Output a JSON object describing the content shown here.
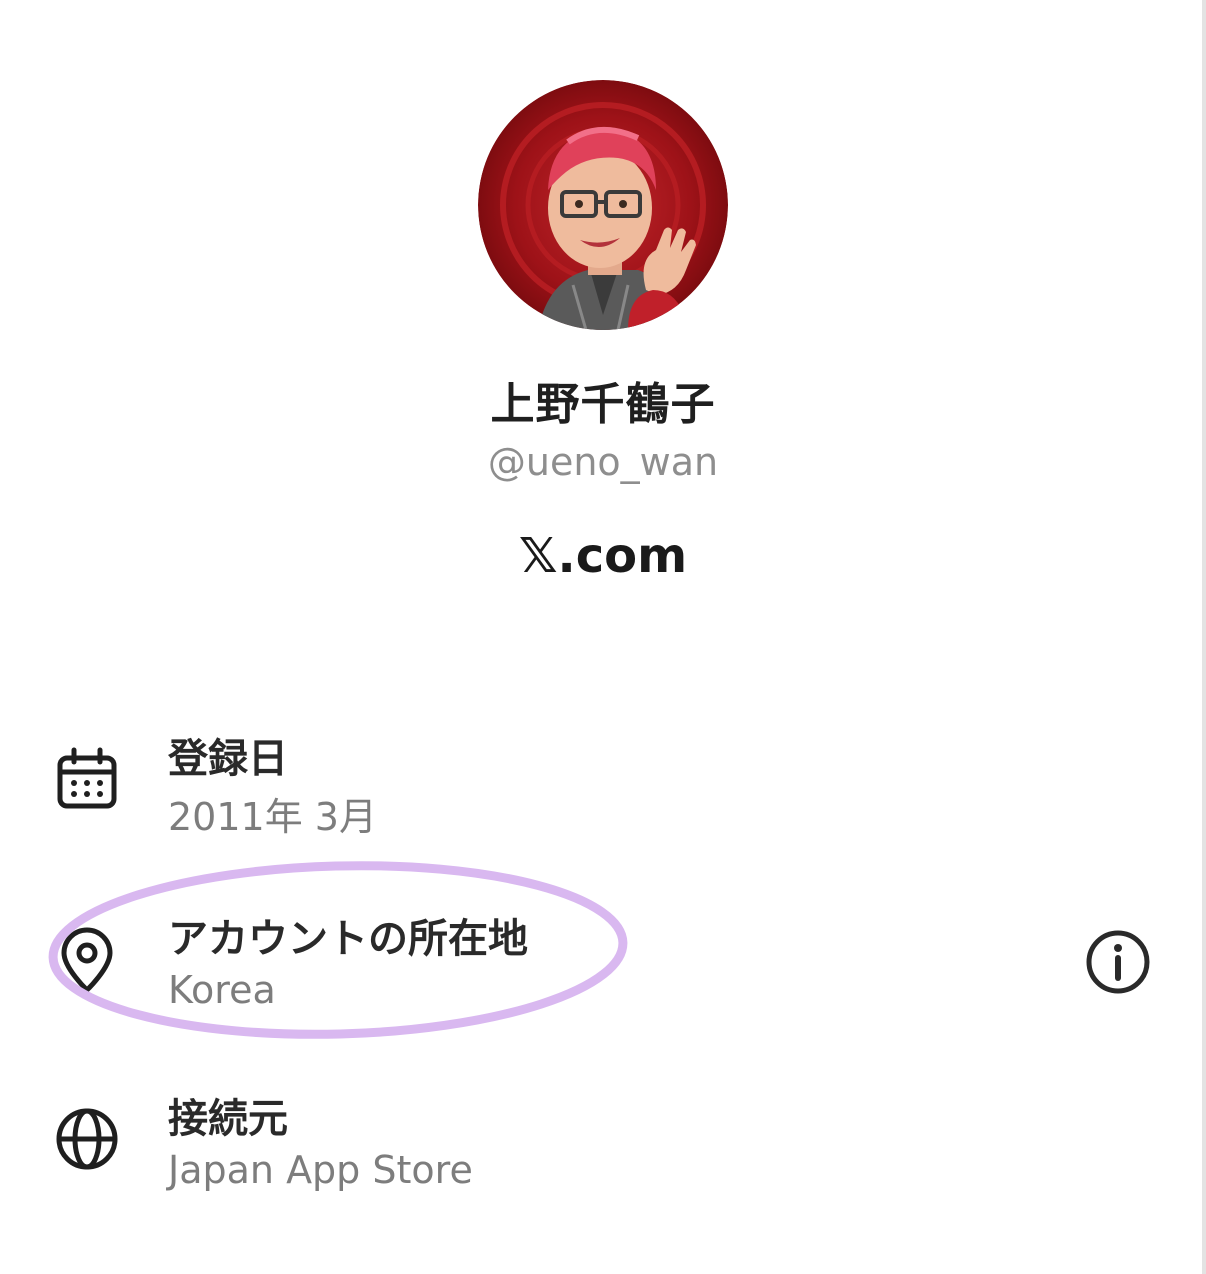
{
  "profile": {
    "display_name": "上野千鶴子",
    "handle": "@ueno_wan",
    "avatar_icon": "avatar-image"
  },
  "brand": {
    "label": "𝕏.com"
  },
  "details": {
    "joined": {
      "label": "登録日",
      "value": "2011年 3月",
      "icon": "calendar-icon"
    },
    "location": {
      "label": "アカウントの所在地",
      "value": "Korea",
      "icon": "location-pin-icon",
      "info_icon": "info-icon",
      "highlight_color": "#d9b8f0"
    },
    "connected_via": {
      "label": "接続元",
      "value": "Japan App Store",
      "icon": "globe-icon"
    }
  },
  "colors": {
    "text_primary": "#1f1f1f",
    "text_secondary": "#8e8e8e",
    "avatar_background": "#a8141a"
  }
}
